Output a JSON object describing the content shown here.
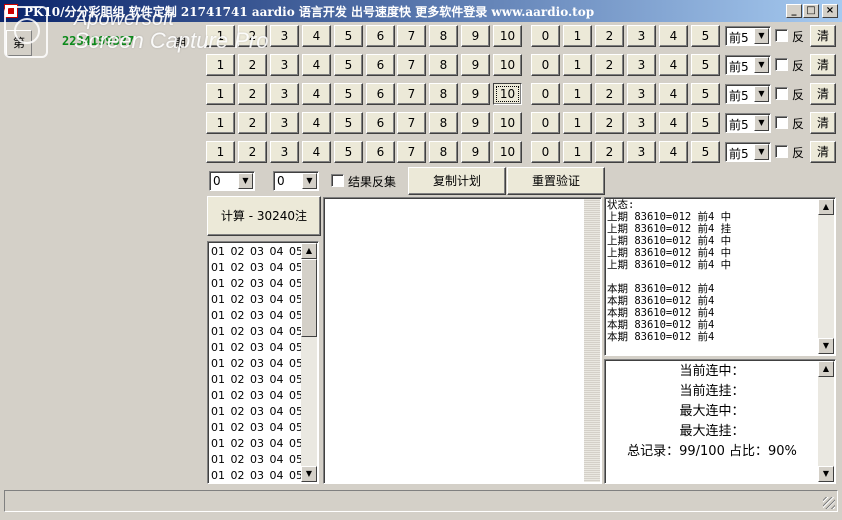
{
  "window": {
    "title": "PK10/分分彩胆组 软件定制 21741741 aardio 语言开发 出号速度快 更多软件登录 www.aardio.top",
    "controls": {
      "minimize": "_",
      "maximize": "□",
      "close": "×"
    }
  },
  "watermark": {
    "line1": "Apowersoft",
    "line2": "Screen Capture Pro"
  },
  "period": {
    "prefix": "第",
    "number": "2234199327",
    "suffix": "期"
  },
  "grid": {
    "left_numbers": [
      "1",
      "2",
      "3",
      "4",
      "5",
      "6",
      "7",
      "8",
      "9",
      "10"
    ],
    "right_numbers": [
      "0",
      "1",
      "2",
      "3",
      "4",
      "5"
    ],
    "rows": [
      {
        "position": "前5",
        "reverse_label": "反",
        "clear_label": "清"
      },
      {
        "position": "前5",
        "reverse_label": "反",
        "clear_label": "清"
      },
      {
        "position": "前5",
        "reverse_label": "反",
        "clear_label": "清"
      },
      {
        "position": "前5",
        "reverse_label": "反",
        "clear_label": "清"
      },
      {
        "position": "前5",
        "reverse_label": "反",
        "clear_label": "清"
      }
    ],
    "focused": {
      "row": 2,
      "number": "10"
    }
  },
  "controls": {
    "select1": "0",
    "select2": "0",
    "result_reverse_label": "结果反集",
    "copy_plan_label": "复制计划",
    "reset_verify_label": "重置验证",
    "compute_label": "计算 - 30240注"
  },
  "combinations": [
    "01 02 03 04 05",
    "01 02 03 04 05",
    "01 02 03 04 05",
    "01 02 03 04 05",
    "01 02 03 04 05",
    "01 02 03 04 05",
    "01 02 03 04 05",
    "01 02 03 04 05",
    "01 02 03 04 05",
    "01 02 03 04 05",
    "01 02 03 04 05",
    "01 02 03 04 05",
    "01 02 03 04 05",
    "01 02 03 04 05",
    "01 02 03 04 05"
  ],
  "status_log": {
    "lines": [
      "状态:",
      "上期 83610=012 前4 中",
      "上期 83610=012 前4 挂",
      "上期 83610=012 前4 中",
      "上期 83610=012 前4 中",
      "上期 83610=012 前4 中",
      "",
      "本期 83610=012 前4",
      "本期 83610=012 前4",
      "本期 83610=012 前4",
      "本期 83610=012 前4",
      "本期 83610=012 前4"
    ]
  },
  "stats": {
    "current_win_streak": "当前连中：",
    "current_loss_streak": "当前连挂：",
    "max_win_streak": "最大连中：",
    "max_loss_streak": "最大连挂：",
    "total_record": "总记录：99/100 占比：90%"
  }
}
